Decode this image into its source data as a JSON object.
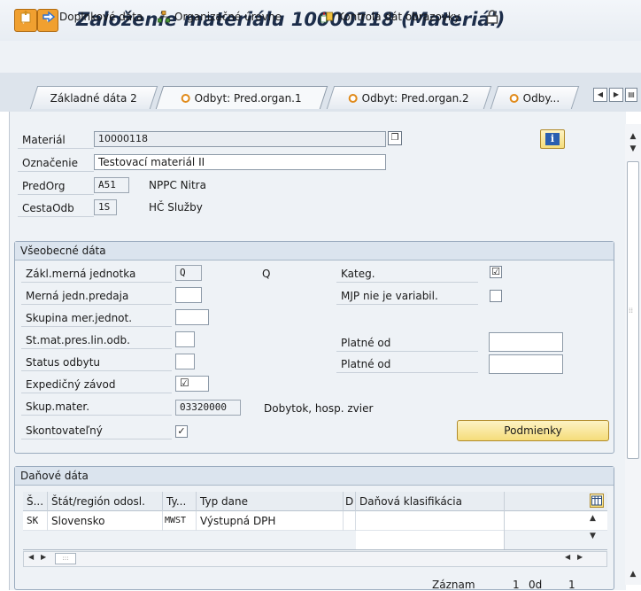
{
  "window": {
    "title": "Založenie materiálu 10000118 (Materiál)"
  },
  "toolbar": {
    "items": [
      {
        "label": "Doplnkové dáta",
        "icon": "arrow-right-icon"
      },
      {
        "label": "Organizačné úrovne",
        "icon": "org-levels-icon"
      },
      {
        "label": "Kontrola dát obrazovky",
        "icon": "check-data-icon"
      }
    ]
  },
  "tabs": [
    {
      "label": "Základné dáta 2",
      "active": false
    },
    {
      "label": "Odbyt: Pred.organ.1",
      "active": true
    },
    {
      "label": "Odbyt: Pred.organ.2",
      "active": false
    },
    {
      "label": "Odby...",
      "active": false
    }
  ],
  "header": {
    "material_label": "Materiál",
    "material_value": "10000118",
    "designation_label": "Označenie",
    "designation_value": "Testovací materiál II",
    "salesorg_label": "PredOrg",
    "salesorg_code": "A51",
    "salesorg_name": "NPPC Nitra",
    "distchannel_label": "CestaOdb",
    "distchannel_code": "1S",
    "distchannel_name": "HČ Služby"
  },
  "general": {
    "title": "Všeobecné dáta",
    "base_uom_label": "Zákl.merná jednotka",
    "base_uom_value": "Q",
    "base_uom_text": "Q",
    "sales_unit_label": "Merná jedn.predaja",
    "sales_unit_value": "",
    "uom_group_label": "Skupina mer.jednot.",
    "uom_group_value": "",
    "xdist_status_label": "St.mat.pres.lin.odb.",
    "xdist_status_value": "",
    "sales_status_label": "Status odbytu",
    "sales_status_value": "",
    "delivering_plant_label": "Expedičný závod",
    "delivering_plant_value": "☑",
    "mat_group_label": "Skup.mater.",
    "mat_group_value": "03320000",
    "mat_group_text": "Dobytok, hosp. zvier",
    "cash_discount_label": "Skontovateľný",
    "cash_discount_value": "✓",
    "category_label": "Kateg.",
    "category_value": "☑",
    "var_uom_label": "MJP nie je variabil.",
    "valid_from_label_1": "Platné od",
    "valid_from_label_2": "Platné od",
    "conditions_button": "Podmienky"
  },
  "tax": {
    "title": "Daňové dáta",
    "columns": [
      "Š...",
      "Štát/región odosl.",
      "Ty...",
      "Typ dane",
      "D",
      "Daňová klasifikácia"
    ],
    "rows": [
      [
        "SK",
        "Slovensko",
        "MWST",
        "Výstupná DPH",
        "",
        ""
      ]
    ]
  },
  "footer": {
    "entry_label": "Záznam",
    "entry_value": "1",
    "of_label": "0d",
    "total_value": "1"
  },
  "colors": {
    "accent": "#f0a030",
    "background": "#eef2f6",
    "title_text": "#1c2d4a"
  }
}
